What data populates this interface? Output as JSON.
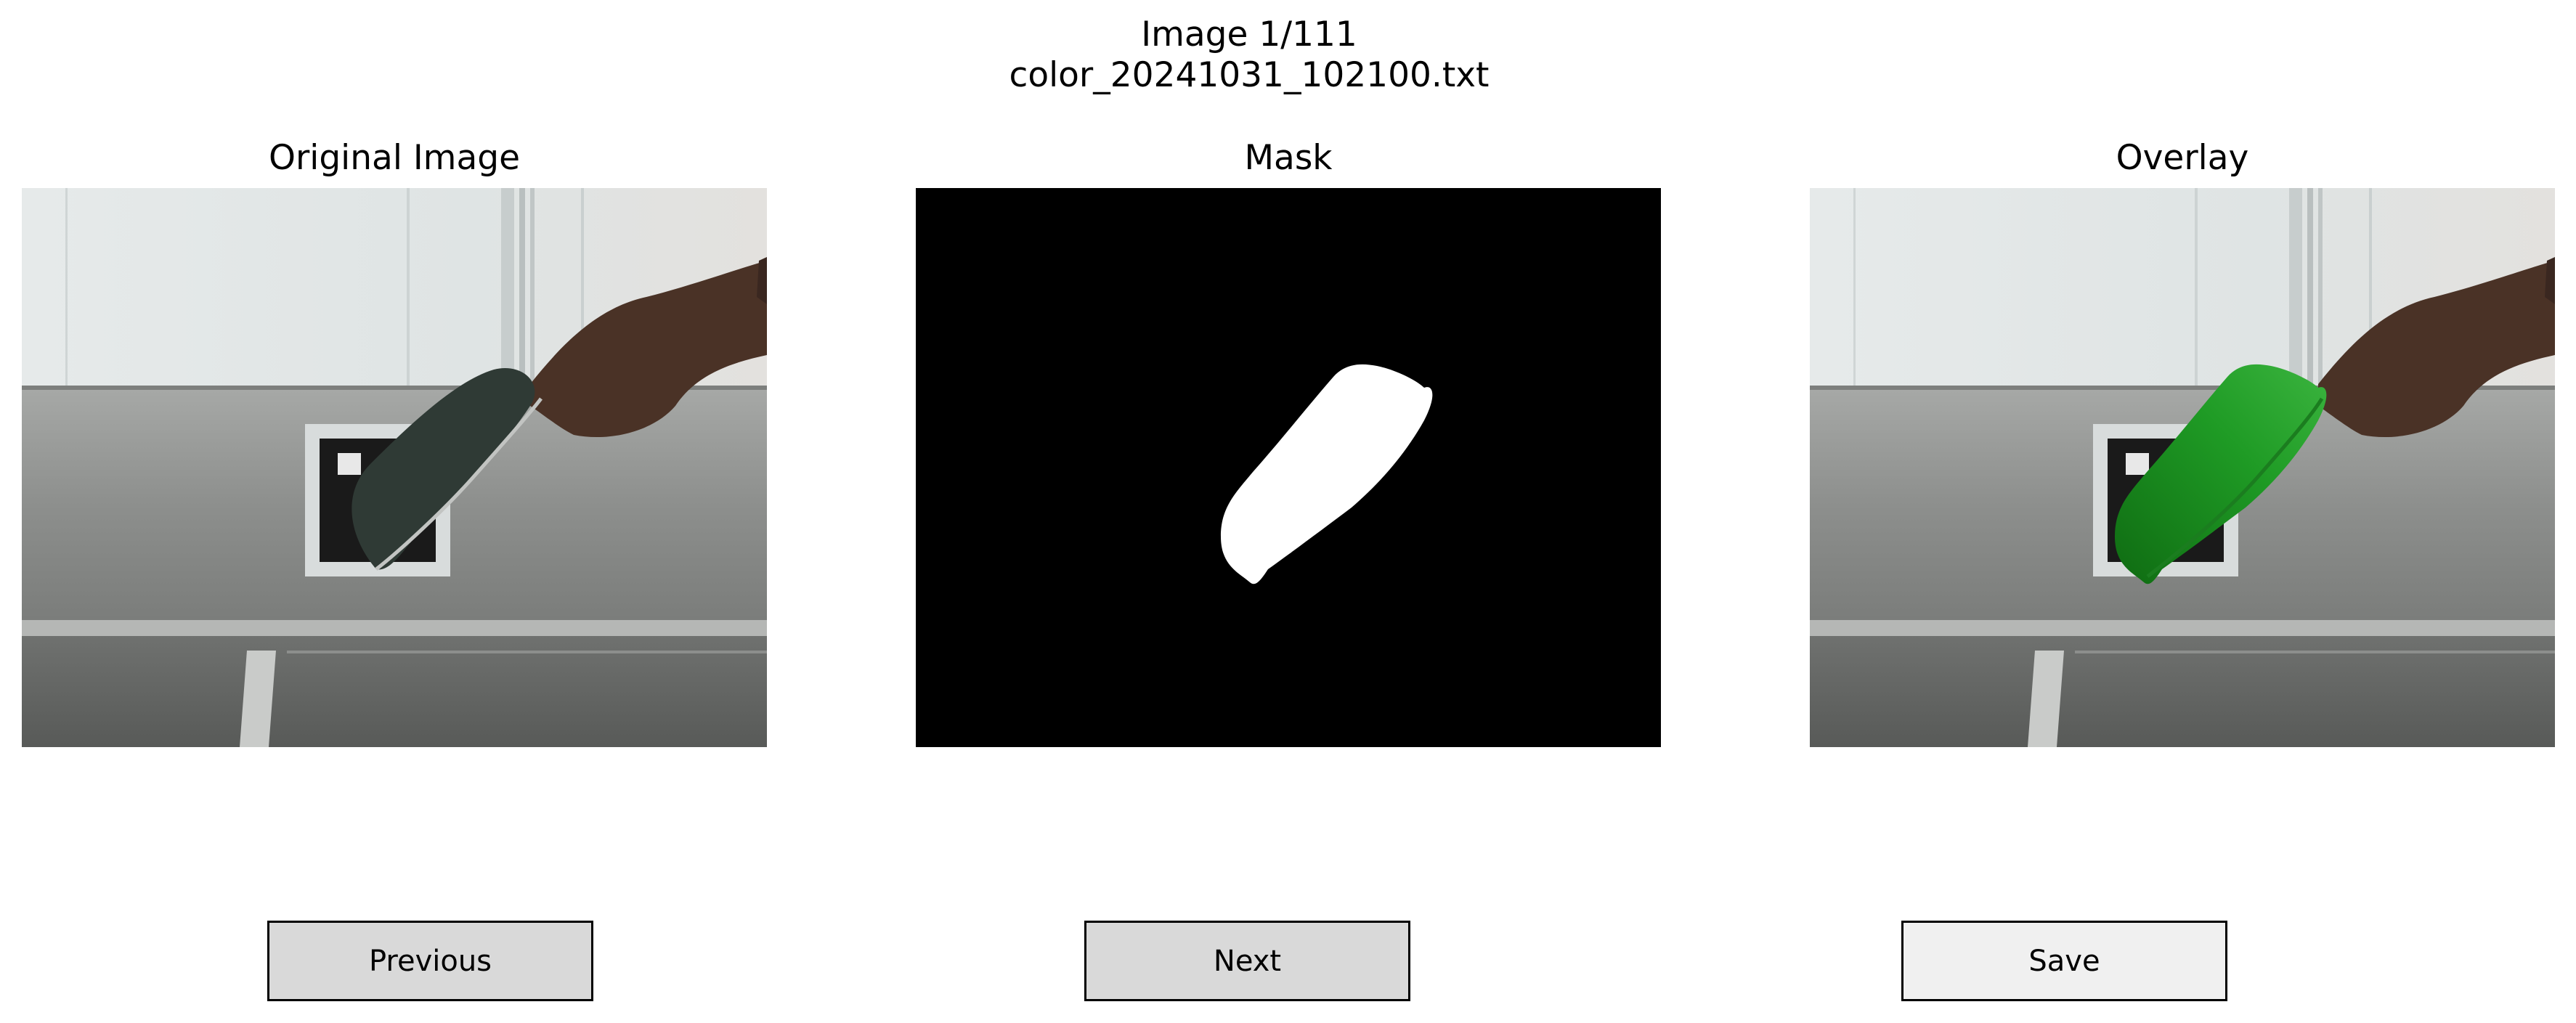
{
  "header": {
    "counter": "Image 1/111",
    "filename": "color_20241031_102100.txt"
  },
  "panels": [
    {
      "title": "Original Image"
    },
    {
      "title": "Mask"
    },
    {
      "title": "Overlay"
    }
  ],
  "buttons": {
    "previous": "Previous",
    "next": "Next",
    "save": "Save"
  },
  "colors": {
    "button_face": "#d9d9d9",
    "button_face_save": "#f0f0f0",
    "overlay_tint": "#1f9b25",
    "mask_background": "#000000",
    "mask_foreground": "#ffffff"
  }
}
